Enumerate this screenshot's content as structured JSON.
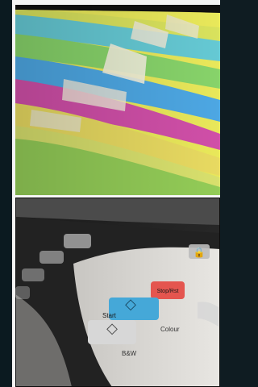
{
  "image_panels": [
    {
      "name": "colored-file-folders-photo"
    },
    {
      "name": "copier-control-panel-photo"
    }
  ],
  "copier_labels": {
    "stop_reset": "Stop/Rst",
    "start": "Start",
    "color": "Colour",
    "black": "B&W"
  },
  "colors": {
    "frame_dark": "#0b1a20",
    "panel_gray": "#dcdad6",
    "start_blue": "#45a8d8",
    "stop_red": "#e4554f"
  }
}
